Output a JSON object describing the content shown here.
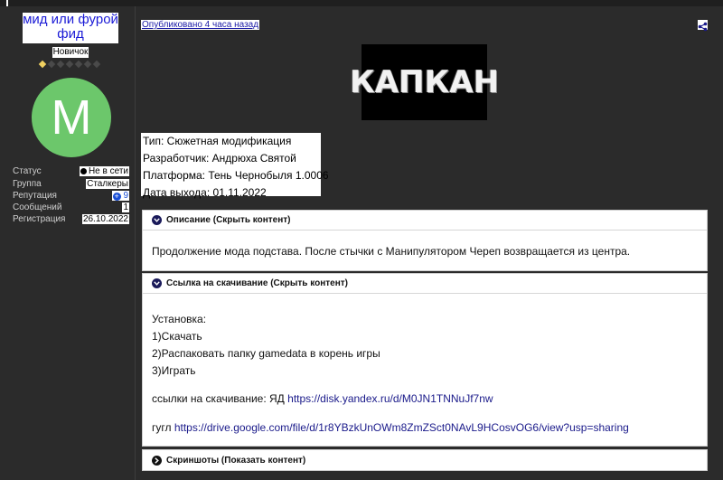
{
  "profile": {
    "username": "мид или фурой фид",
    "rank": "Новичок",
    "rank_pips_total": 7,
    "rank_pips_filled": 1,
    "avatar_letter": "M",
    "avatar_color": "#6cc76b",
    "stats": {
      "status_label": "Статус",
      "status_value": "Не в сети",
      "group_label": "Группа",
      "group_value": "Сталкеры",
      "reputation_label": "Репутация",
      "reputation_value": "9",
      "posts_label": "Сообщений",
      "posts_value": "1",
      "registered_label": "Регистрация",
      "registered_value": "26.10.2022"
    }
  },
  "post": {
    "published": "Опубликовано 4 часа назад",
    "banner_text": "КАПКАН",
    "info": {
      "type": "Тип: Сюжетная модификация",
      "developer": "Разработчик: Андрюха Святой",
      "platform": "Платформа: Тень Чернобыля 1.0006",
      "release": "Дата выхода: 01.11.2022"
    },
    "spoilers": [
      {
        "title": "Описание (Скрыть контент)",
        "text": "Продолжение мода подстава. После стычки с Манипулятором Череп возвращается из центра."
      },
      {
        "title": "Ссылка на скачивание (Скрыть контент)",
        "install_heading": "Установка:",
        "steps": [
          "1)Скачать",
          "2)Распаковать папку gamedata в корень игры",
          "3)Играть"
        ],
        "links_label_yandex": "ссылки на скачивание: ЯД ",
        "yandex_url": "https://disk.yandex.ru/d/M0JN1TNNuJf7nw",
        "links_label_google": "гугл ",
        "google_url": "https://drive.google.com/file/d/1r8YBzkUnOWm8ZmZSct0NAvL9HCosvOG6/view?usp=sharing"
      },
      {
        "title": "Скриншоты (Показать контент)"
      }
    ]
  },
  "colors": {
    "background": "#2b2b2b",
    "link": "#1a1a8a",
    "username": "#1a1ad6"
  }
}
